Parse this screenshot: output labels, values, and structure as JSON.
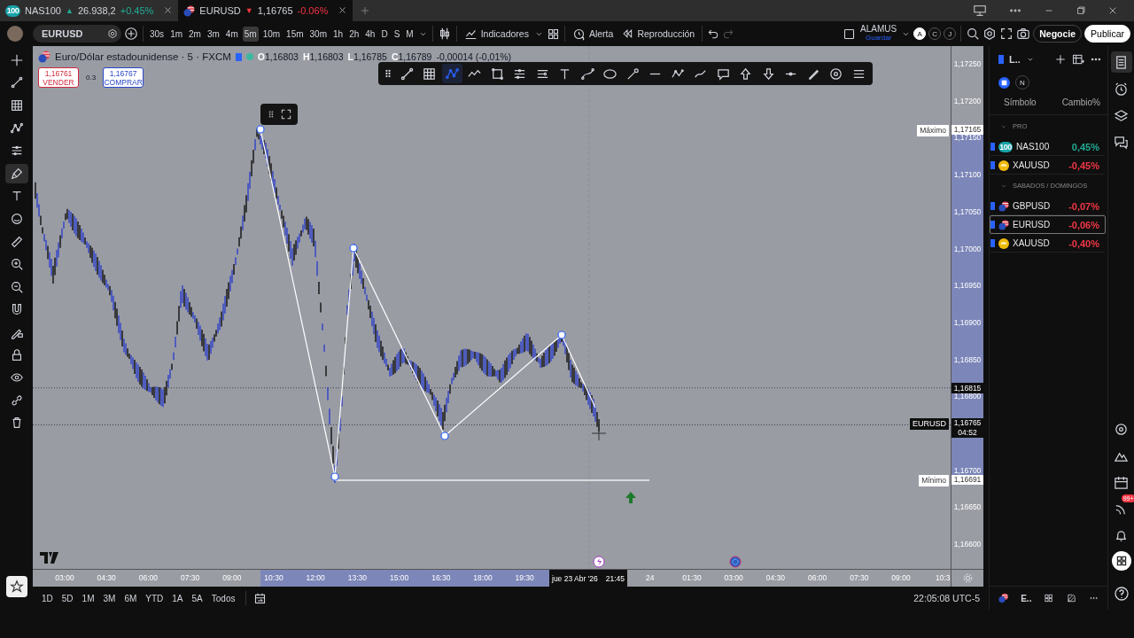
{
  "tabs": [
    {
      "kind": "index",
      "badge": "100",
      "symbol": "NAS100",
      "arrow": "▲",
      "color": "#22ab94",
      "price": "26.938,2",
      "change": "+0.45%",
      "selected": false
    },
    {
      "kind": "forex",
      "symbol": "EURUSD",
      "arrow": "▼",
      "color": "#f23645",
      "price": "1,16765",
      "change": "-0.06%",
      "selected": true
    }
  ],
  "toolbar": {
    "symbol": "EURUSD",
    "intervals": [
      {
        "label": "30s",
        "selected": false
      },
      {
        "label": "1m",
        "selected": false
      },
      {
        "label": "2m",
        "selected": false
      },
      {
        "label": "3m",
        "selected": false
      },
      {
        "label": "4m",
        "selected": false
      },
      {
        "label": "5m",
        "selected": true
      },
      {
        "label": "10m",
        "selected": false
      },
      {
        "label": "15m",
        "selected": false
      },
      {
        "label": "30m",
        "selected": false
      },
      {
        "label": "1h",
        "selected": false
      },
      {
        "label": "2h",
        "selected": false
      },
      {
        "label": "4h",
        "selected": false
      },
      {
        "label": "D",
        "selected": false
      },
      {
        "label": "S",
        "selected": false
      },
      {
        "label": "M",
        "selected": false
      }
    ],
    "indicators": "Indicadores",
    "alert": "Alerta",
    "replay": "Reproducción",
    "redo_disabled": true,
    "layout": {
      "name": "ALAMUS",
      "action": "Guardar"
    },
    "profiles": [
      {
        "letter": "A",
        "selected": true
      },
      {
        "letter": "C",
        "selected": false
      },
      {
        "letter": "J",
        "selected": false
      }
    ],
    "trade_button": "Negocie",
    "publish_button": "Publicar"
  },
  "left_tools": [
    {
      "kind": "crosshair",
      "selected": false
    },
    {
      "kind": "trend-line",
      "selected": false
    },
    {
      "kind": "grid",
      "selected": false
    },
    {
      "kind": "node-pattern",
      "selected": false
    },
    {
      "kind": "parallel-lines",
      "selected": false
    },
    {
      "kind": "brush",
      "selected": true
    },
    {
      "kind": "text",
      "selected": false
    },
    {
      "kind": "smile",
      "selected": false
    },
    {
      "kind": "ruler",
      "selected": false
    },
    {
      "kind": "zoom-in",
      "selected": false
    },
    {
      "kind": "zoom-out",
      "selected": false
    },
    {
      "kind": "magnet",
      "selected": false
    },
    {
      "kind": "pencil-lock",
      "selected": false
    },
    {
      "kind": "lock",
      "selected": false
    },
    {
      "kind": "eye",
      "selected": false
    },
    {
      "kind": "link",
      "selected": false
    },
    {
      "kind": "trash",
      "selected": false
    }
  ],
  "drawing_toolbar": [
    {
      "kind": "trend-line",
      "selected": false
    },
    {
      "kind": "grid",
      "selected": false
    },
    {
      "kind": "node-pattern",
      "selected": true
    },
    {
      "kind": "wave",
      "selected": false
    },
    {
      "kind": "rectangle",
      "selected": false
    },
    {
      "kind": "parallel-lines",
      "selected": false
    },
    {
      "kind": "channel",
      "selected": false
    },
    {
      "kind": "text",
      "selected": false
    },
    {
      "kind": "curve",
      "selected": false
    },
    {
      "kind": "ellipse",
      "selected": false
    },
    {
      "kind": "line-circle",
      "selected": false
    },
    {
      "kind": "dash",
      "selected": false
    },
    {
      "kind": "points",
      "selected": false
    },
    {
      "kind": "check",
      "selected": false
    },
    {
      "kind": "comment",
      "selected": false
    },
    {
      "kind": "arrow-up",
      "selected": false
    },
    {
      "kind": "arrow-down",
      "selected": false
    },
    {
      "kind": "dot-line",
      "selected": false
    },
    {
      "kind": "pen",
      "selected": false
    },
    {
      "kind": "target",
      "selected": false
    },
    {
      "kind": "menu",
      "selected": false
    }
  ],
  "chart": {
    "legend": {
      "title": "Euro/Dólar estadounidense · 5 · FXCM",
      "ohlc": [
        {
          "key": "O",
          "value": "1,16803"
        },
        {
          "key": "H",
          "value": "1,16803"
        },
        {
          "key": "L",
          "value": "1,16785"
        },
        {
          "key": "C",
          "value": "1,16789"
        }
      ],
      "change": "-0,00014 (-0,01%)"
    },
    "trade": {
      "sell_price": "1,16761",
      "sell_label": "VENDER",
      "spread": "0.3",
      "buy_price": "1,16767",
      "buy_label": "COMPRAR"
    },
    "pattern": {
      "selected": true
    },
    "price_labels": [
      "1,17250",
      "1,17200",
      "1,17150",
      "1,17100",
      "1,17050",
      "1,17000",
      "1,16950",
      "1,16900",
      "1,16850",
      "1,16800",
      "1,16700",
      "1,16650",
      "1,16600"
    ],
    "price_tags": [
      {
        "kind": "max",
        "label": "Máximo",
        "value": "1,17165"
      },
      {
        "kind": "crosshair",
        "value": "1,16815"
      },
      {
        "kind": "last",
        "label": "EURUSD",
        "value": "1,16765",
        "countdown": "04:52"
      },
      {
        "kind": "min",
        "label": "Mínimo",
        "value": "1,16691"
      }
    ],
    "time_labels_before": [
      "03:00",
      "04:30",
      "06:00",
      "07:30",
      "09:00",
      "10:30",
      "12:00",
      "13:30",
      "15:00",
      "16:30",
      "18:00",
      "19:30"
    ],
    "cursor_date": "jue 23 Abr '26",
    "cursor_time": "21:45",
    "time_labels_after": [
      "24",
      "01:30",
      "03:00",
      "04:30",
      "06:00",
      "07:30",
      "09:00",
      "10:3"
    ]
  },
  "ranges": [
    "1D",
    "5D",
    "1M",
    "3M",
    "6M",
    "YTD",
    "1A",
    "5A",
    "Todos"
  ],
  "clock": "22:05:08 UTC-5",
  "watchlist": {
    "name": "L..",
    "news_label": "N",
    "columns": [
      "Símbolo",
      "Cambio%"
    ],
    "sections": [
      {
        "title": "PRO",
        "expanded": true,
        "items": [
          {
            "kind": "index",
            "badge": "100",
            "symbol": "NAS100",
            "change": "0,45%",
            "color": "#22ab94",
            "selected": false
          },
          {
            "kind": "metal",
            "symbol": "XAUUSD",
            "change": "-0,45%",
            "color": "#f23645",
            "selected": false
          }
        ]
      },
      {
        "title": "SABADOS / DOMINGOS",
        "expanded": true,
        "items": [
          {
            "kind": "forex",
            "symbol": "GBPUSD",
            "change": "-0,07%",
            "color": "#f23645",
            "selected": false
          },
          {
            "kind": "forex",
            "symbol": "EURUSD",
            "change": "-0,06%",
            "color": "#f23645",
            "selected": true
          },
          {
            "kind": "metal",
            "symbol": "XAUUSD",
            "change": "-0,40%",
            "color": "#f23645",
            "selected": false
          }
        ]
      }
    ],
    "footer_symbol": "E.."
  },
  "right_bar": [
    {
      "kind": "list",
      "selected": true
    },
    {
      "kind": "alarm",
      "selected": false
    },
    {
      "kind": "layers",
      "selected": false
    },
    {
      "kind": "chat",
      "selected": false
    }
  ],
  "right_bar_bottom": [
    {
      "kind": "target"
    },
    {
      "kind": "mountains"
    },
    {
      "kind": "calendar"
    },
    {
      "kind": "feed",
      "badge": "99+"
    },
    {
      "kind": "bell"
    }
  ]
}
